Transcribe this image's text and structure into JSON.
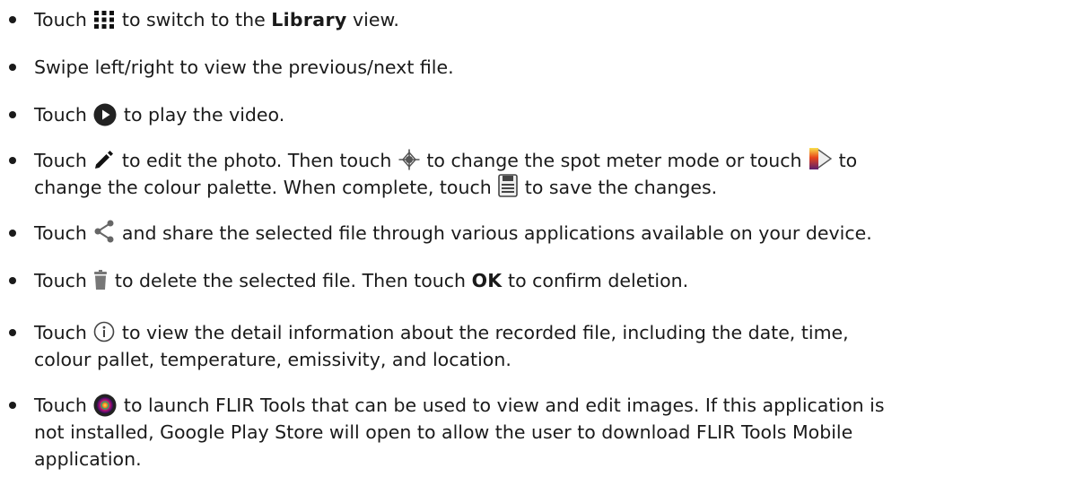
{
  "items": [
    {
      "t1": "Touch",
      "t2": "to switch to the",
      "b1": "Library",
      "t3": "view.",
      "icon": "grid-icon"
    },
    {
      "t1": "Swipe left/right to view the previous/next file."
    },
    {
      "t1": "Touch",
      "t2": "to play the video.",
      "icon": "play-icon"
    },
    {
      "t1": "Touch",
      "t2": "to edit the photo. Then touch",
      "t3": "to change the spot meter mode or touch",
      "t4": "to",
      "t5": "change the colour palette. When complete, touch",
      "t6": "to save the changes.",
      "icons": [
        "pencil-icon",
        "spot-meter-icon",
        "palette-icon",
        "save-icon"
      ]
    },
    {
      "t1": "Touch",
      "t2": "and share the selected file through various applications available on your device.",
      "icon": "share-icon"
    },
    {
      "t1": "Touch",
      "t2": "to delete the selected file. Then touch",
      "b1": "OK",
      "t3": "to confirm deletion.",
      "icon": "trash-icon"
    },
    {
      "t1": "Touch",
      "t2": "to view the detail information about the recorded file, including the date, time,",
      "t3": "colour pallet, temperature, emissivity, and location.",
      "icon": "info-icon"
    },
    {
      "t1": "Touch",
      "t2": "to launch FLIR Tools that can be used to view and edit images. If this application is",
      "t3": "not installed, Google Play Store will open to allow the user to download FLIR Tools Mobile",
      "t4": "application.",
      "icon": "flir-tools-icon"
    }
  ]
}
